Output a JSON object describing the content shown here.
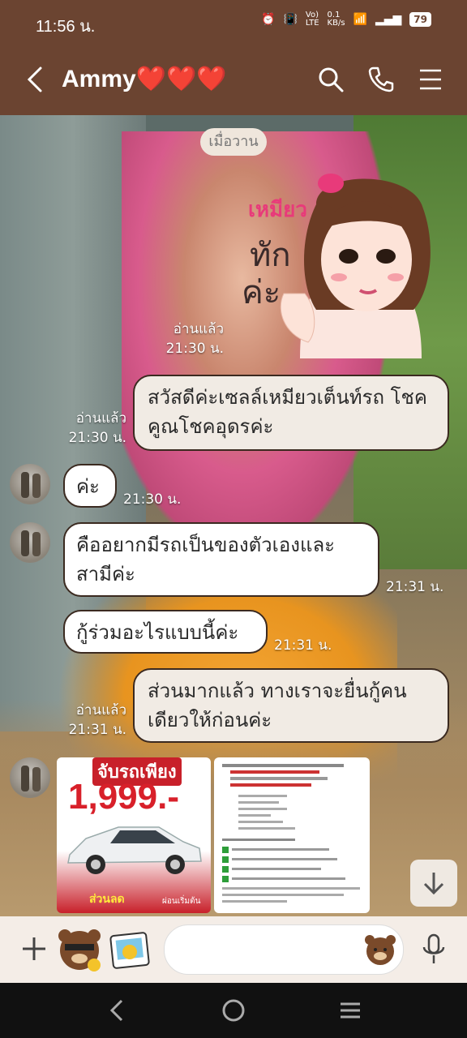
{
  "status": {
    "time": "11:56 น.",
    "net_speed": "0.1\nKB/s",
    "battery": "79"
  },
  "header": {
    "title": "Ammy❤️❤️❤️"
  },
  "chat": {
    "date": "เมื่อวาน",
    "sticker": {
      "text1": "เหมียว",
      "text2": "ทัก",
      "text3": "ค่ะ",
      "read": "อ่านแล้ว",
      "time": "21:30 น."
    },
    "messages": [
      {
        "side": "right",
        "text": "สวัสดีค่ะเซลล์เหมียวเต็นท์รถ โชคคูณโชคอุดรค่ะ",
        "read": "อ่านแล้ว",
        "time": "21:30 น."
      },
      {
        "side": "left",
        "text": "ค่ะ",
        "time": "21:30 น."
      },
      {
        "side": "left",
        "text": "คืออยากมีรถเป็นของตัวเองและสามีค่ะ",
        "time": "21:31 น."
      },
      {
        "side": "left",
        "text": "กู้ร่วมอะไรแบบนี้ค่ะ",
        "time": "21:31 น."
      },
      {
        "side": "right",
        "text": "ส่วนมากแล้ว ทางเราจะยื่นกู้คนเดียวให้ก่อนค่ะ",
        "read": "อ่านแล้ว",
        "time": "21:31 น."
      }
    ],
    "promo": {
      "headline": "จับรถเพียง",
      "price": "1,999.-",
      "footer_left": "ส่วนลด",
      "footer_right": "ผ่อนเริ่มต้น"
    }
  },
  "colors": {
    "header_bg": "#6b4431",
    "bubble_border": "#3b2a20",
    "input_bg": "#f4ede7"
  },
  "icons": [
    "back-icon",
    "search-icon",
    "phone-icon",
    "menu-icon",
    "plus-icon",
    "brown-sticker-icon",
    "photo-sticker-icon",
    "emoji-icon",
    "mic-icon",
    "scroll-down-icon"
  ]
}
